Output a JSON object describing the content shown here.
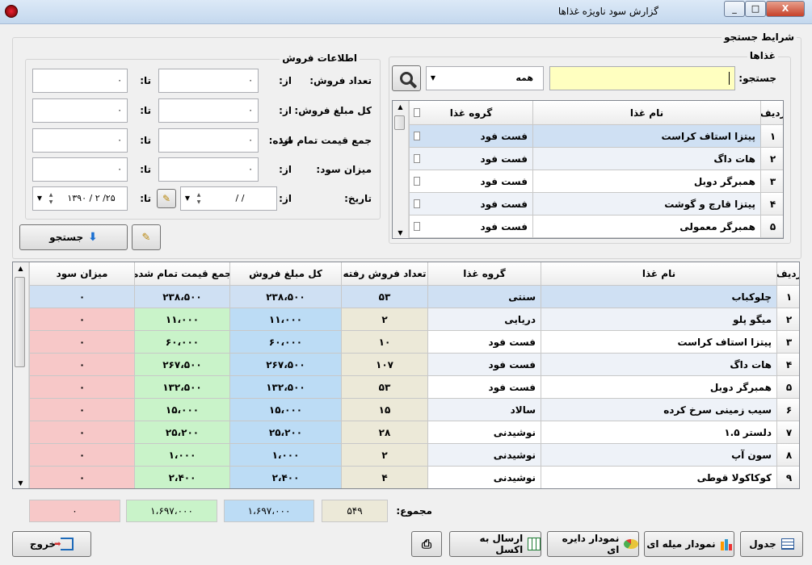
{
  "window": {
    "title": "گزارش سود ناویژه غذاها",
    "controls": [
      "_",
      "□",
      "X"
    ]
  },
  "search": {
    "group_title": "شرایط جستجو",
    "foods_title": "غذاها",
    "search_label": "جستجو:",
    "search_value": "",
    "category_value": "همه",
    "sales_title": "اطلاعات فروش",
    "from_label": "از:",
    "to_label": "تا:",
    "fields": [
      {
        "label": "تعداد فروش:",
        "from": "۰",
        "to": "۰"
      },
      {
        "label": "کل مبلغ فروش:",
        "from": "۰",
        "to": "۰"
      },
      {
        "label": "جمع قیمت تمام شده:",
        "from": "۰",
        "to": "۰"
      },
      {
        "label": "میزان سود:",
        "from": "۰",
        "to": "۰"
      }
    ],
    "date_label": "تاریخ:",
    "date_from": "/     /",
    "date_to": "۱۳۹۰ / ۲ /۲۵",
    "search_button": "جستجو"
  },
  "food_table": {
    "headers": [
      "ردیف",
      "نام غذا",
      "گروه غذا"
    ],
    "rows": [
      {
        "no": "۱",
        "name": "پیتزا استاف کراست",
        "group": "فست فود"
      },
      {
        "no": "۲",
        "name": "هات داگ",
        "group": "فست فود"
      },
      {
        "no": "۳",
        "name": "همبرگر دوبل",
        "group": "فست فود"
      },
      {
        "no": "۴",
        "name": "پیتزا قارچ و گوشت",
        "group": "فست فود"
      },
      {
        "no": "۵",
        "name": "همبرگر معمولی",
        "group": "فست فود"
      }
    ]
  },
  "report_table": {
    "headers": [
      "ردیف",
      "نام غذا",
      "گروه غذا",
      "تعداد فروش رفته",
      "کل مبلغ فروش",
      "جمع قیمت تمام شده",
      "میزان سود"
    ],
    "rows": [
      {
        "no": "۱",
        "name": "چلوکباب",
        "group": "سنتی",
        "count": "۵۳",
        "total": "۲۳۸،۵۰۰",
        "cost": "۲۳۸،۵۰۰",
        "profit": "۰"
      },
      {
        "no": "۲",
        "name": "میگو پلو",
        "group": "دریایی",
        "count": "۲",
        "total": "۱۱،۰۰۰",
        "cost": "۱۱،۰۰۰",
        "profit": "۰"
      },
      {
        "no": "۳",
        "name": "پیتزا استاف کراست",
        "group": "فست فود",
        "count": "۱۰",
        "total": "۶۰،۰۰۰",
        "cost": "۶۰،۰۰۰",
        "profit": "۰"
      },
      {
        "no": "۴",
        "name": "هات داگ",
        "group": "فست فود",
        "count": "۱۰۷",
        "total": "۲۶۷،۵۰۰",
        "cost": "۲۶۷،۵۰۰",
        "profit": "۰"
      },
      {
        "no": "۵",
        "name": "همبرگر دوبل",
        "group": "فست فود",
        "count": "۵۳",
        "total": "۱۳۲،۵۰۰",
        "cost": "۱۳۲،۵۰۰",
        "profit": "۰"
      },
      {
        "no": "۶",
        "name": "سیب زمینی سرخ کرده",
        "group": "سالاد",
        "count": "۱۵",
        "total": "۱۵،۰۰۰",
        "cost": "۱۵،۰۰۰",
        "profit": "۰"
      },
      {
        "no": "۷",
        "name": "دلستر ۱.۵",
        "group": "نوشیدنی",
        "count": "۲۸",
        "total": "۲۵،۲۰۰",
        "cost": "۲۵،۲۰۰",
        "profit": "۰"
      },
      {
        "no": "۸",
        "name": "سون آپ",
        "group": "نوشیدنی",
        "count": "۲",
        "total": "۱،۰۰۰",
        "cost": "۱،۰۰۰",
        "profit": "۰"
      },
      {
        "no": "۹",
        "name": "کوکاکولا قوطی",
        "group": "نوشیدنی",
        "count": "۴",
        "total": "۲،۴۰۰",
        "cost": "۲،۴۰۰",
        "profit": "۰"
      }
    ]
  },
  "totals": {
    "label": "مجموع:",
    "count": "۵۴۹",
    "total": "۱،۶۹۷،۰۰۰",
    "cost": "۱،۶۹۷،۰۰۰",
    "profit": "۰"
  },
  "buttons": {
    "table": "جدول",
    "bar_chart": "نمودار میله ای",
    "pie_chart": "نمودار دایره ای",
    "excel": "ارسال به اکسل",
    "exit": "خروج"
  },
  "colors": {
    "count_col": "#ece9d8",
    "total_col": "#bcdcf5",
    "cost_col": "#c9f3c9",
    "profit_col": "#f7c8c8",
    "selected": "#cfe0f3",
    "search_bg": "#ffffc0"
  }
}
